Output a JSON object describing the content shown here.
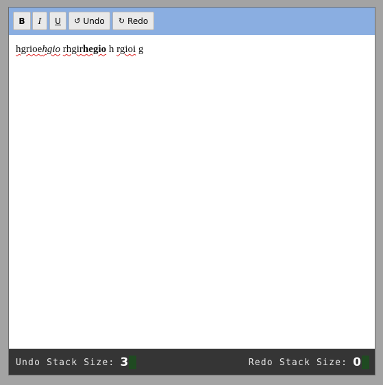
{
  "toolbar": {
    "bold_label": "B",
    "italic_label": "I",
    "underline_label": "U",
    "undo_icon": "↺",
    "undo_label": "Undo",
    "redo_icon": "↻",
    "redo_label": "Redo"
  },
  "editor": {
    "segments": [
      {
        "text": "hgrioe",
        "style": "spell"
      },
      {
        "text": "hgio",
        "style": "italic-spell"
      },
      {
        "text": " ",
        "style": "plain"
      },
      {
        "text": "rhgir",
        "style": "spell"
      },
      {
        "text": "hegio",
        "style": "bold-spell"
      },
      {
        "text": " h ",
        "style": "plain"
      },
      {
        "text": "rgioi",
        "style": "spell"
      },
      {
        "text": " g",
        "style": "plain"
      }
    ]
  },
  "status": {
    "undo_label": "Undo Stack Size:",
    "undo_value": "3",
    "redo_label": "Redo Stack Size:",
    "redo_value": "0"
  },
  "colors": {
    "toolbar_bg": "#8aaee1",
    "status_bg": "#353535",
    "counter_swatch": "#1f4a21",
    "spellcheck": "#dd2222"
  }
}
